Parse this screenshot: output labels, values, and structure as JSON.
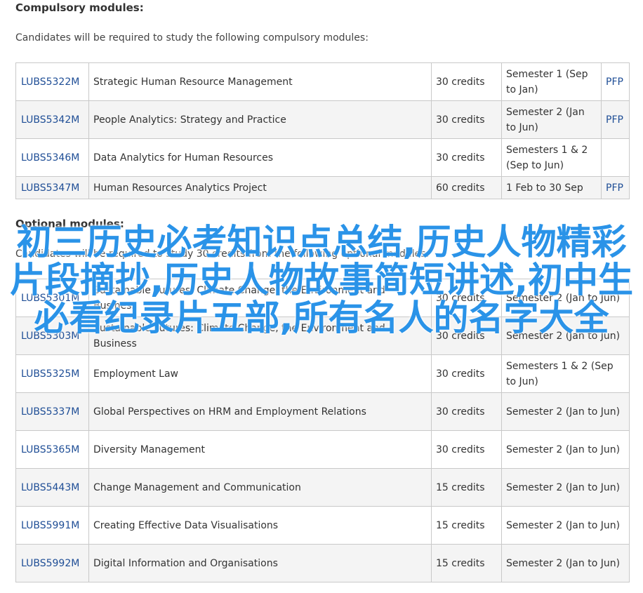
{
  "compulsory": {
    "heading": "Compulsory modules:",
    "intro": "Candidates will be required to study the following compulsory modules:",
    "rows": [
      {
        "code": "LUBS5322M",
        "title": "Strategic Human Resource Management",
        "credits": "30 credits",
        "semester": "Semester 1 (Sep to Jan)",
        "pfp": "PFP"
      },
      {
        "code": "LUBS5342M",
        "title": "People Analytics: Strategy and Practice",
        "credits": "30 credits",
        "semester": "Semester 2 (Jan to Jun)",
        "pfp": "PFP"
      },
      {
        "code": "LUBS5346M",
        "title": "Data Analytics for Human Resources",
        "credits": "30 credits",
        "semester": "Semesters 1 & 2 (Sep to Jun)",
        "pfp": ""
      },
      {
        "code": "LUBS5347M",
        "title": "Human Resources Analytics Project",
        "credits": "60 credits",
        "semester": "1 Feb to 30 Sep",
        "pfp": "PFP"
      }
    ]
  },
  "optional": {
    "heading": "Optional modules:",
    "intro": "Candidates will be required to study 30 credits from the following optional modules:",
    "rows": [
      {
        "code": "LUBS5301M",
        "title": "Sustainable Futures: Climate Change, the Environment and Business",
        "credits": "30 credits",
        "semester": "Semester 2 (Jan to Jun)"
      },
      {
        "code": "LUBS5303M",
        "title": "Sustainable Futures: Climate Change, the Environment and Business",
        "credits": "30 credits",
        "semester": "Semester 2 (Jan to Jun)"
      },
      {
        "code": "LUBS5325M",
        "title": "Employment Law",
        "credits": "30 credits",
        "semester": "Semesters 1 & 2 (Sep to Jun)"
      },
      {
        "code": "LUBS5337M",
        "title": "Global Perspectives on HRM and Employment Relations",
        "credits": "30 credits",
        "semester": "Semester 2 (Jan to Jun)"
      },
      {
        "code": "LUBS5365M",
        "title": "Diversity Management",
        "credits": "30 credits",
        "semester": "Semester 2 (Jan to Jun)"
      },
      {
        "code": "LUBS5443M",
        "title": "Change Management and Communication",
        "credits": "15 credits",
        "semester": "Semester 2 (Jan to Jun)"
      },
      {
        "code": "LUBS5991M",
        "title": "Creating Effective Data Visualisations",
        "credits": "15 credits",
        "semester": "Semester 2 (Jan to Jun)"
      },
      {
        "code": "LUBS5992M",
        "title": "Digital Information and Organisations",
        "credits": "15 credits",
        "semester": "Semester 2 (Jan to Jun)"
      }
    ]
  },
  "overlay_text": "初三历史必考知识点总结,历史人物精彩片段摘抄,历史人物故事简短讲述,初中生必看纪录片五部,所有名人的名字大全",
  "colors": {
    "link": "#1f4e96",
    "overlay": "#2a93e8",
    "border": "#c9c9c9"
  }
}
